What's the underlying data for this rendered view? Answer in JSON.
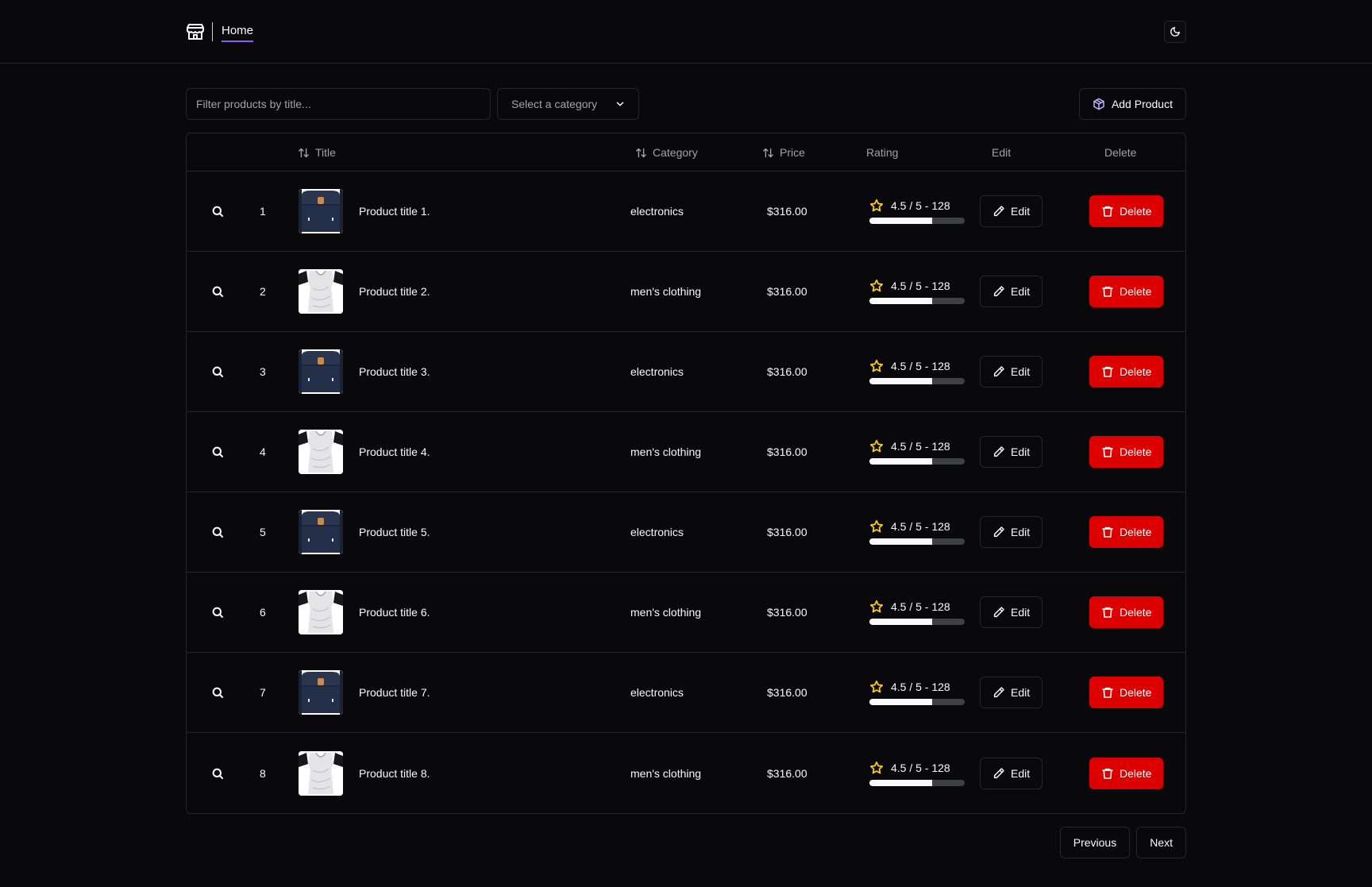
{
  "header": {
    "nav_home": "Home"
  },
  "toolbar": {
    "filter_placeholder": "Filter products by title...",
    "category_select": "Select a category",
    "add_product": "Add Product"
  },
  "table": {
    "columns": {
      "title": "Title",
      "category": "Category",
      "price": "Price",
      "rating": "Rating",
      "edit": "Edit",
      "delete": "Delete"
    },
    "rows": [
      {
        "index": "1",
        "title": "Product title 1.",
        "category": "electronics",
        "price": "$316.00",
        "rating": "4.5 / 5 - 128",
        "rating_fraction": 0.66,
        "image": "backpack"
      },
      {
        "index": "2",
        "title": "Product title 2.",
        "category": "men's clothing",
        "price": "$316.00",
        "rating": "4.5 / 5 - 128",
        "rating_fraction": 0.66,
        "image": "tshirt"
      },
      {
        "index": "3",
        "title": "Product title 3.",
        "category": "electronics",
        "price": "$316.00",
        "rating": "4.5 / 5 - 128",
        "rating_fraction": 0.66,
        "image": "backpack"
      },
      {
        "index": "4",
        "title": "Product title 4.",
        "category": "men's clothing",
        "price": "$316.00",
        "rating": "4.5 / 5 - 128",
        "rating_fraction": 0.66,
        "image": "tshirt"
      },
      {
        "index": "5",
        "title": "Product title 5.",
        "category": "electronics",
        "price": "$316.00",
        "rating": "4.5 / 5 - 128",
        "rating_fraction": 0.66,
        "image": "backpack"
      },
      {
        "index": "6",
        "title": "Product title 6.",
        "category": "men's clothing",
        "price": "$316.00",
        "rating": "4.5 / 5 - 128",
        "rating_fraction": 0.66,
        "image": "tshirt"
      },
      {
        "index": "7",
        "title": "Product title 7.",
        "category": "electronics",
        "price": "$316.00",
        "rating": "4.5 / 5 - 128",
        "rating_fraction": 0.66,
        "image": "backpack"
      },
      {
        "index": "8",
        "title": "Product title 8.",
        "category": "men's clothing",
        "price": "$316.00",
        "rating": "4.5 / 5 - 128",
        "rating_fraction": 0.66,
        "image": "tshirt"
      }
    ],
    "edit_label": "Edit",
    "delete_label": "Delete"
  },
  "pagination": {
    "previous": "Previous",
    "next": "Next"
  },
  "colors": {
    "accent": "#8b5cf6",
    "danger": "#dc0000",
    "star": "#facc15",
    "background": "#09090b",
    "border": "#27272a"
  }
}
